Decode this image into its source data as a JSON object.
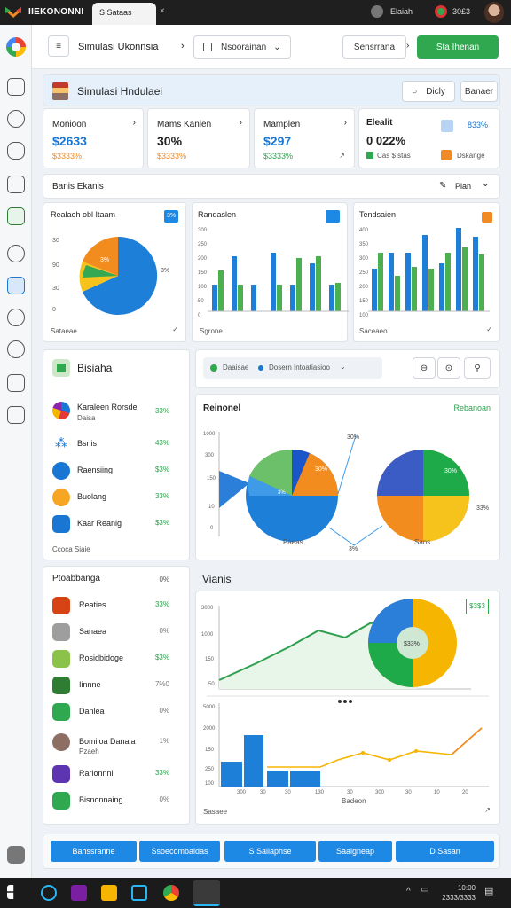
{
  "topbar": {
    "app_title": "IIEKONONNI",
    "tab_label": "S Sataas",
    "tab_close": "×",
    "status1": "Elaiah",
    "status2": "30£3",
    "notif_icon": "person-icon"
  },
  "header": {
    "nav_title": "Simulasi Ukonnsia",
    "dropdown": "Nsoorainan",
    "btn1": "Sensrrana",
    "btn2": "Sta Ihenan"
  },
  "banner": {
    "title": "Simulasi Hndulaei",
    "btn_display": "Dicly",
    "btn_other": "Banaer"
  },
  "stats": [
    {
      "label": "Monioon",
      "value": "$2633",
      "sub": "$3333%"
    },
    {
      "label": "Mams Kanlen",
      "value": "30%",
      "sub": "$3333%"
    },
    {
      "label": "Mamplen",
      "value": "$297",
      "sub": "$3333%"
    },
    {
      "label": "Elealit",
      "value": "0 022%",
      "sub": "Cas $ stas",
      "right_top": "833%",
      "right_sub": "Dskange"
    }
  ],
  "section_bar": {
    "title": "Banis Ekanis",
    "btn": "Plan"
  },
  "chart1": {
    "title": "Realaeh obl Itaam",
    "pct": "3%",
    "footer": "Sataeae",
    "slice_label": "3%"
  },
  "chart2": {
    "title": "Randaslen",
    "footer": "Sgrone",
    "y_ticks": [
      "300",
      "250",
      "200",
      "150",
      "100",
      "50",
      "0"
    ]
  },
  "chart3": {
    "title": "Tendsaien",
    "footer": "Saceaeo",
    "y_ticks": [
      "400",
      "350",
      "300",
      "250",
      "200",
      "150",
      "100",
      "50"
    ]
  },
  "biaslist": {
    "title": "Bisiaha",
    "footer": "Ccoca Siaie",
    "items": [
      {
        "name": "Karaleen Rorsde",
        "sub": "Daisa",
        "pct": "33%"
      },
      {
        "name": "Bsnis",
        "pct": "43%"
      },
      {
        "name": "Raensiing",
        "pct": "$3%"
      },
      {
        "name": "Buolang",
        "pct": "33%"
      },
      {
        "name": "Kaar Reanig",
        "pct": "$3%"
      }
    ]
  },
  "filterbar": {
    "chip1": "Daaisae",
    "chip2": "Dosern Intoatiasioo"
  },
  "pies": {
    "title": "Reinonel",
    "link": "Rebanoan",
    "label_left": "Paeas",
    "label_right": "Sans",
    "pct1": "30%",
    "pct2": "3%",
    "pct3": "33%"
  },
  "list2": {
    "title": "Ptoabbanga",
    "title_pct": "0%",
    "items": [
      {
        "name": "Reaties",
        "pct": "33%"
      },
      {
        "name": "Sanaea",
        "pct": "0%"
      },
      {
        "name": "Rosidbidoge",
        "pct": "$3%"
      },
      {
        "name": "Iinnne",
        "pct": "7%0"
      },
      {
        "name": "Danlea",
        "pct": "0%"
      },
      {
        "name": "Bomiloa Danala",
        "sub": "Pzaeh",
        "pct": "1%"
      },
      {
        "name": "Rarionnnl",
        "pct": "33%"
      },
      {
        "name": "Bisnonnaing",
        "pct": "0%"
      }
    ]
  },
  "vianis": {
    "title": "Vianis",
    "badge": "$3$3",
    "pie_label": "$33%",
    "footer_left": "Sasaee",
    "footer_mid": "Badeon",
    "y_ticks1": [
      "3000",
      "1000",
      "150",
      "50"
    ],
    "y_ticks2": [
      "5000",
      "2000",
      "150",
      "250",
      "100",
      "50"
    ]
  },
  "bottom_buttons": [
    "Bahssranne",
    "Ssoecombaidas",
    "S Sailaphse",
    "Saaigneap",
    "D Sasan"
  ],
  "taskbar": {
    "time": "10:00",
    "date": "2333/3333"
  },
  "colors": {
    "accent": "#1976d2",
    "green": "#2fa84f",
    "orange": "#f08a24",
    "yellow": "#f6b500"
  }
}
